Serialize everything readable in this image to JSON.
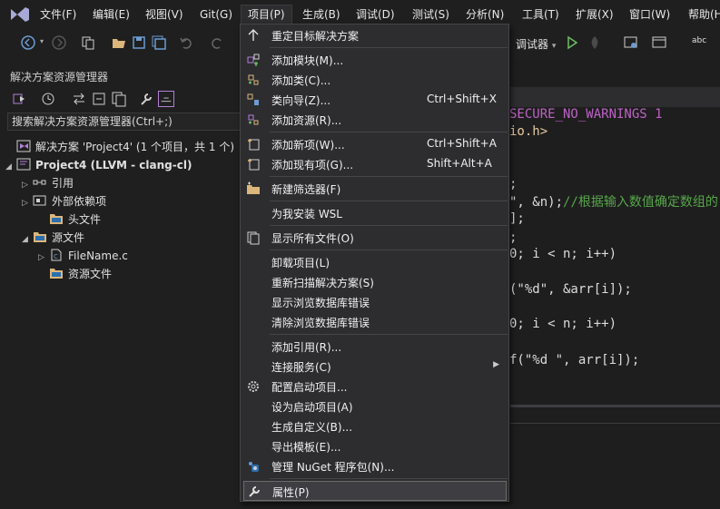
{
  "menubar": {
    "items": [
      "文件(F)",
      "编辑(E)",
      "视图(V)",
      "Git(G)",
      "项目(P)",
      "生成(B)",
      "调试(D)",
      "测试(S)",
      "分析(N)",
      "工具(T)",
      "扩展(X)",
      "窗口(W)",
      "帮助(H"
    ],
    "active_index": 4
  },
  "toolbar": {
    "debugger_label": "调试器",
    "debugger_arrow": "▾"
  },
  "solution_explorer": {
    "title": "解决方案资源管理器",
    "search_placeholder": "搜索解决方案资源管理器(Ctrl+;)",
    "tree": [
      {
        "label": "解决方案 'Project4' (1 个项目，共 1 个)",
        "icon": "solution-icon",
        "arrow": ""
      },
      {
        "label": "Project4 (LLVM - clang-cl)",
        "icon": "project-icon",
        "arrow": "◢"
      },
      {
        "label": "引用",
        "icon": "references-icon",
        "arrow": "▷"
      },
      {
        "label": "外部依赖项",
        "icon": "external-deps-icon",
        "arrow": "▷"
      },
      {
        "label": "头文件",
        "icon": "filter-folder-icon",
        "arrow": ""
      },
      {
        "label": "源文件",
        "icon": "filter-folder-icon",
        "arrow": "◢"
      },
      {
        "label": "FileName.c",
        "icon": "c-file-icon",
        "arrow": "▷"
      },
      {
        "label": "资源文件",
        "icon": "filter-folder-icon",
        "arrow": ""
      }
    ]
  },
  "editor": {
    "lines": [
      {
        "segments": [
          {
            "t": "SECURE_NO_WARNINGS 1",
            "c": "#bd63c5"
          }
        ]
      },
      {
        "segments": [
          {
            "t": "io.h>",
            "c": "#e8c9a0"
          }
        ]
      },
      {
        "segments": [
          {
            "t": ";",
            "c": "#dcdcdc"
          }
        ]
      },
      {
        "segments": [
          {
            "t": "\", &n);",
            "c": "#dcdcdc"
          },
          {
            "t": "//根据输入数值确定数组的",
            "c": "#57a64a"
          }
        ]
      },
      {
        "segments": [
          {
            "t": "];",
            "c": "#dcdcdc"
          }
        ]
      },
      {
        "segments": [
          {
            "t": ";",
            "c": "#dcdcdc"
          }
        ]
      },
      {
        "segments": [
          {
            "t": "0; i < n; i++)",
            "c": "#dcdcdc"
          }
        ]
      },
      {
        "segments": [
          {
            "t": "(\"%d\", &arr[i]);",
            "c": "#dcdcdc"
          }
        ]
      },
      {
        "segments": [
          {
            "t": "0; i < n; i++)",
            "c": "#dcdcdc"
          }
        ]
      },
      {
        "segments": [
          {
            "t": "f(\"%d \", arr[i]);",
            "c": "#dcdcdc"
          }
        ]
      }
    ]
  },
  "project_menu": {
    "items": [
      {
        "label": "重定目标解决方案",
        "shortcut": "",
        "icon": "retarget-icon"
      },
      {
        "sep": true
      },
      {
        "label": "添加模块(M)...",
        "shortcut": "",
        "icon": "add-module-icon"
      },
      {
        "label": "添加类(C)...",
        "shortcut": "",
        "icon": "add-class-icon"
      },
      {
        "label": "类向导(Z)...",
        "shortcut": "Ctrl+Shift+X",
        "icon": "class-wizard-icon"
      },
      {
        "label": "添加资源(R)...",
        "shortcut": "",
        "icon": "add-resource-icon"
      },
      {
        "sep": true
      },
      {
        "label": "添加新项(W)...",
        "shortcut": "Ctrl+Shift+A",
        "icon": "add-new-item-icon"
      },
      {
        "label": "添加现有项(G)...",
        "shortcut": "Shift+Alt+A",
        "icon": "add-existing-item-icon"
      },
      {
        "sep": true
      },
      {
        "label": "新建筛选器(F)",
        "shortcut": "",
        "icon": "new-filter-icon"
      },
      {
        "sep": true
      },
      {
        "label": "为我安装 WSL",
        "shortcut": "",
        "icon": ""
      },
      {
        "sep": true
      },
      {
        "label": "显示所有文件(O)",
        "shortcut": "",
        "icon": "show-all-files-icon"
      },
      {
        "sep": true
      },
      {
        "label": "卸载项目(L)",
        "shortcut": "",
        "icon": ""
      },
      {
        "label": "重新扫描解决方案(S)",
        "shortcut": "",
        "icon": ""
      },
      {
        "label": "显示浏览数据库错误",
        "shortcut": "",
        "icon": ""
      },
      {
        "label": "清除浏览数据库错误",
        "shortcut": "",
        "icon": ""
      },
      {
        "sep": true
      },
      {
        "label": "添加引用(R)...",
        "shortcut": "",
        "icon": ""
      },
      {
        "label": "连接服务(C)",
        "shortcut": "",
        "icon": "",
        "submenu": "▶"
      },
      {
        "label": "配置启动项目...",
        "shortcut": "",
        "icon": "gear-icon"
      },
      {
        "label": "设为启动项目(A)",
        "shortcut": "",
        "icon": ""
      },
      {
        "label": "生成自定义(B)...",
        "shortcut": "",
        "icon": ""
      },
      {
        "label": "导出模板(E)...",
        "shortcut": "",
        "icon": ""
      },
      {
        "label": "管理 NuGet 程序包(N)...",
        "shortcut": "",
        "icon": "nuget-icon"
      },
      {
        "sep": true
      },
      {
        "label": "属性(P)",
        "shortcut": "",
        "icon": "wrench-icon",
        "selected": true
      }
    ]
  },
  "colors": {
    "accent": "#68217a",
    "menu_bg": "#2d2d30",
    "editor_bg": "#1e1e1e"
  }
}
